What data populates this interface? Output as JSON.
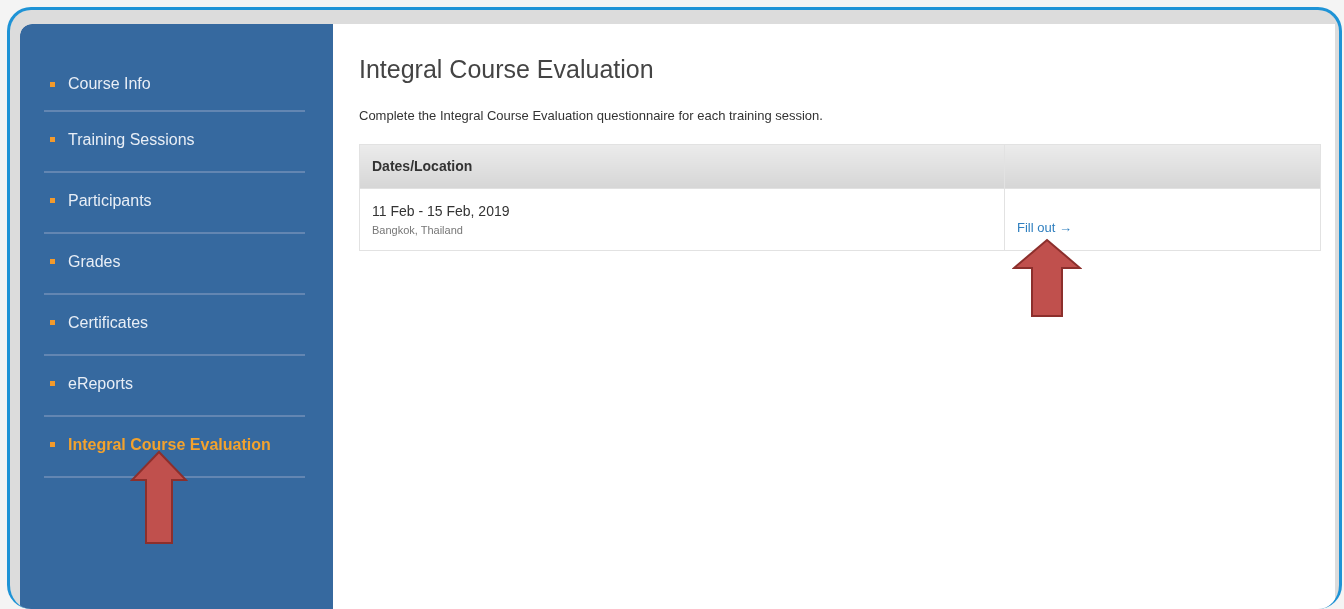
{
  "sidebar": {
    "items": [
      {
        "label": "Course Info",
        "selected": false
      },
      {
        "label": "Training Sessions",
        "selected": false
      },
      {
        "label": "Participants",
        "selected": false
      },
      {
        "label": "Grades",
        "selected": false
      },
      {
        "label": "Certificates",
        "selected": false
      },
      {
        "label": "eReports",
        "selected": false
      },
      {
        "label": "Integral Course Evaluation",
        "selected": true
      }
    ]
  },
  "main": {
    "title": "Integral Course Evaluation",
    "description": "Complete the Integral Course Evaluation questionnaire for each training session.",
    "table": {
      "columns": [
        "Dates/Location"
      ],
      "rows": [
        {
          "dates": "11 Feb - 15 Feb, 2019",
          "location": "Bangkok, Thailand",
          "action": "Fill out →"
        }
      ]
    }
  }
}
